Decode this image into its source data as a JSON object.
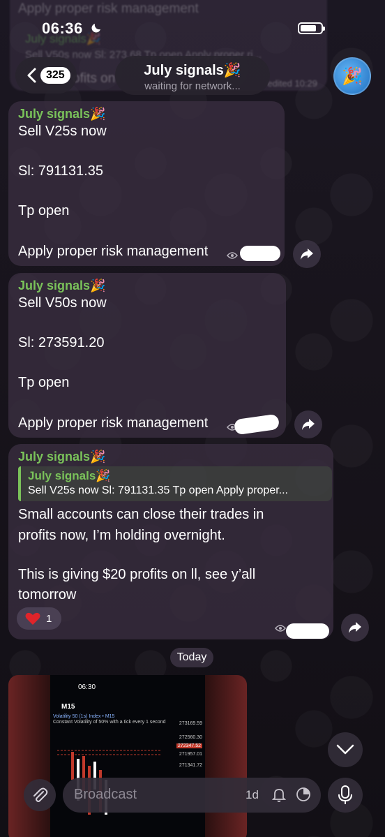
{
  "status_bar": {
    "time": "06:36"
  },
  "ghost_message": {
    "line1": "Apply proper risk management",
    "line2": "July signals🎉",
    "line3": "Sell V50s now Sl: 273.68 Tp open Apply proper ri...",
    "line4": "ofits on",
    "edited": "edited 10:29"
  },
  "header": {
    "unread_count": "325",
    "title": "July signals🎉",
    "subtitle": "waiting for network...",
    "avatar_emoji": "🎉"
  },
  "messages": [
    {
      "author": "July signals🎉",
      "lines": [
        "Sell V25s now",
        "Sl: 791131.35",
        "Tp open",
        "Apply proper risk management"
      ]
    },
    {
      "author": "July signals🎉",
      "lines": [
        "Sell V50s now",
        "Sl: 273591.20",
        "Tp open",
        "Apply proper risk management"
      ]
    },
    {
      "author": "July signals🎉",
      "reply": {
        "author": "July signals🎉",
        "text": "Sell V25s now Sl: 791131.35 Tp open Apply proper..."
      },
      "lines": [
        "Small accounts can close their trades in",
        "profits now, I’m holding overnight.",
        "This is giving $20 profits on ll, see y’all",
        "tomorrow"
      ],
      "reaction": {
        "emoji": "heart-icon",
        "count": "1"
      }
    }
  ],
  "date_separator": "Today",
  "media": {
    "time": "06:30",
    "timeframe": "M15",
    "symbol": "Volatility 50 (1s) Index • M15",
    "description": "Constant Volatility of 50% with a tick every 1 second",
    "prices": [
      "273169.59",
      "272560.30",
      "272347.52",
      "271957.01",
      "271341.72"
    ]
  },
  "composer": {
    "placeholder": "Broadcast",
    "timer": "1d"
  },
  "colors": {
    "author_green": "#7ac25a",
    "bubble": "#3a2e40"
  }
}
